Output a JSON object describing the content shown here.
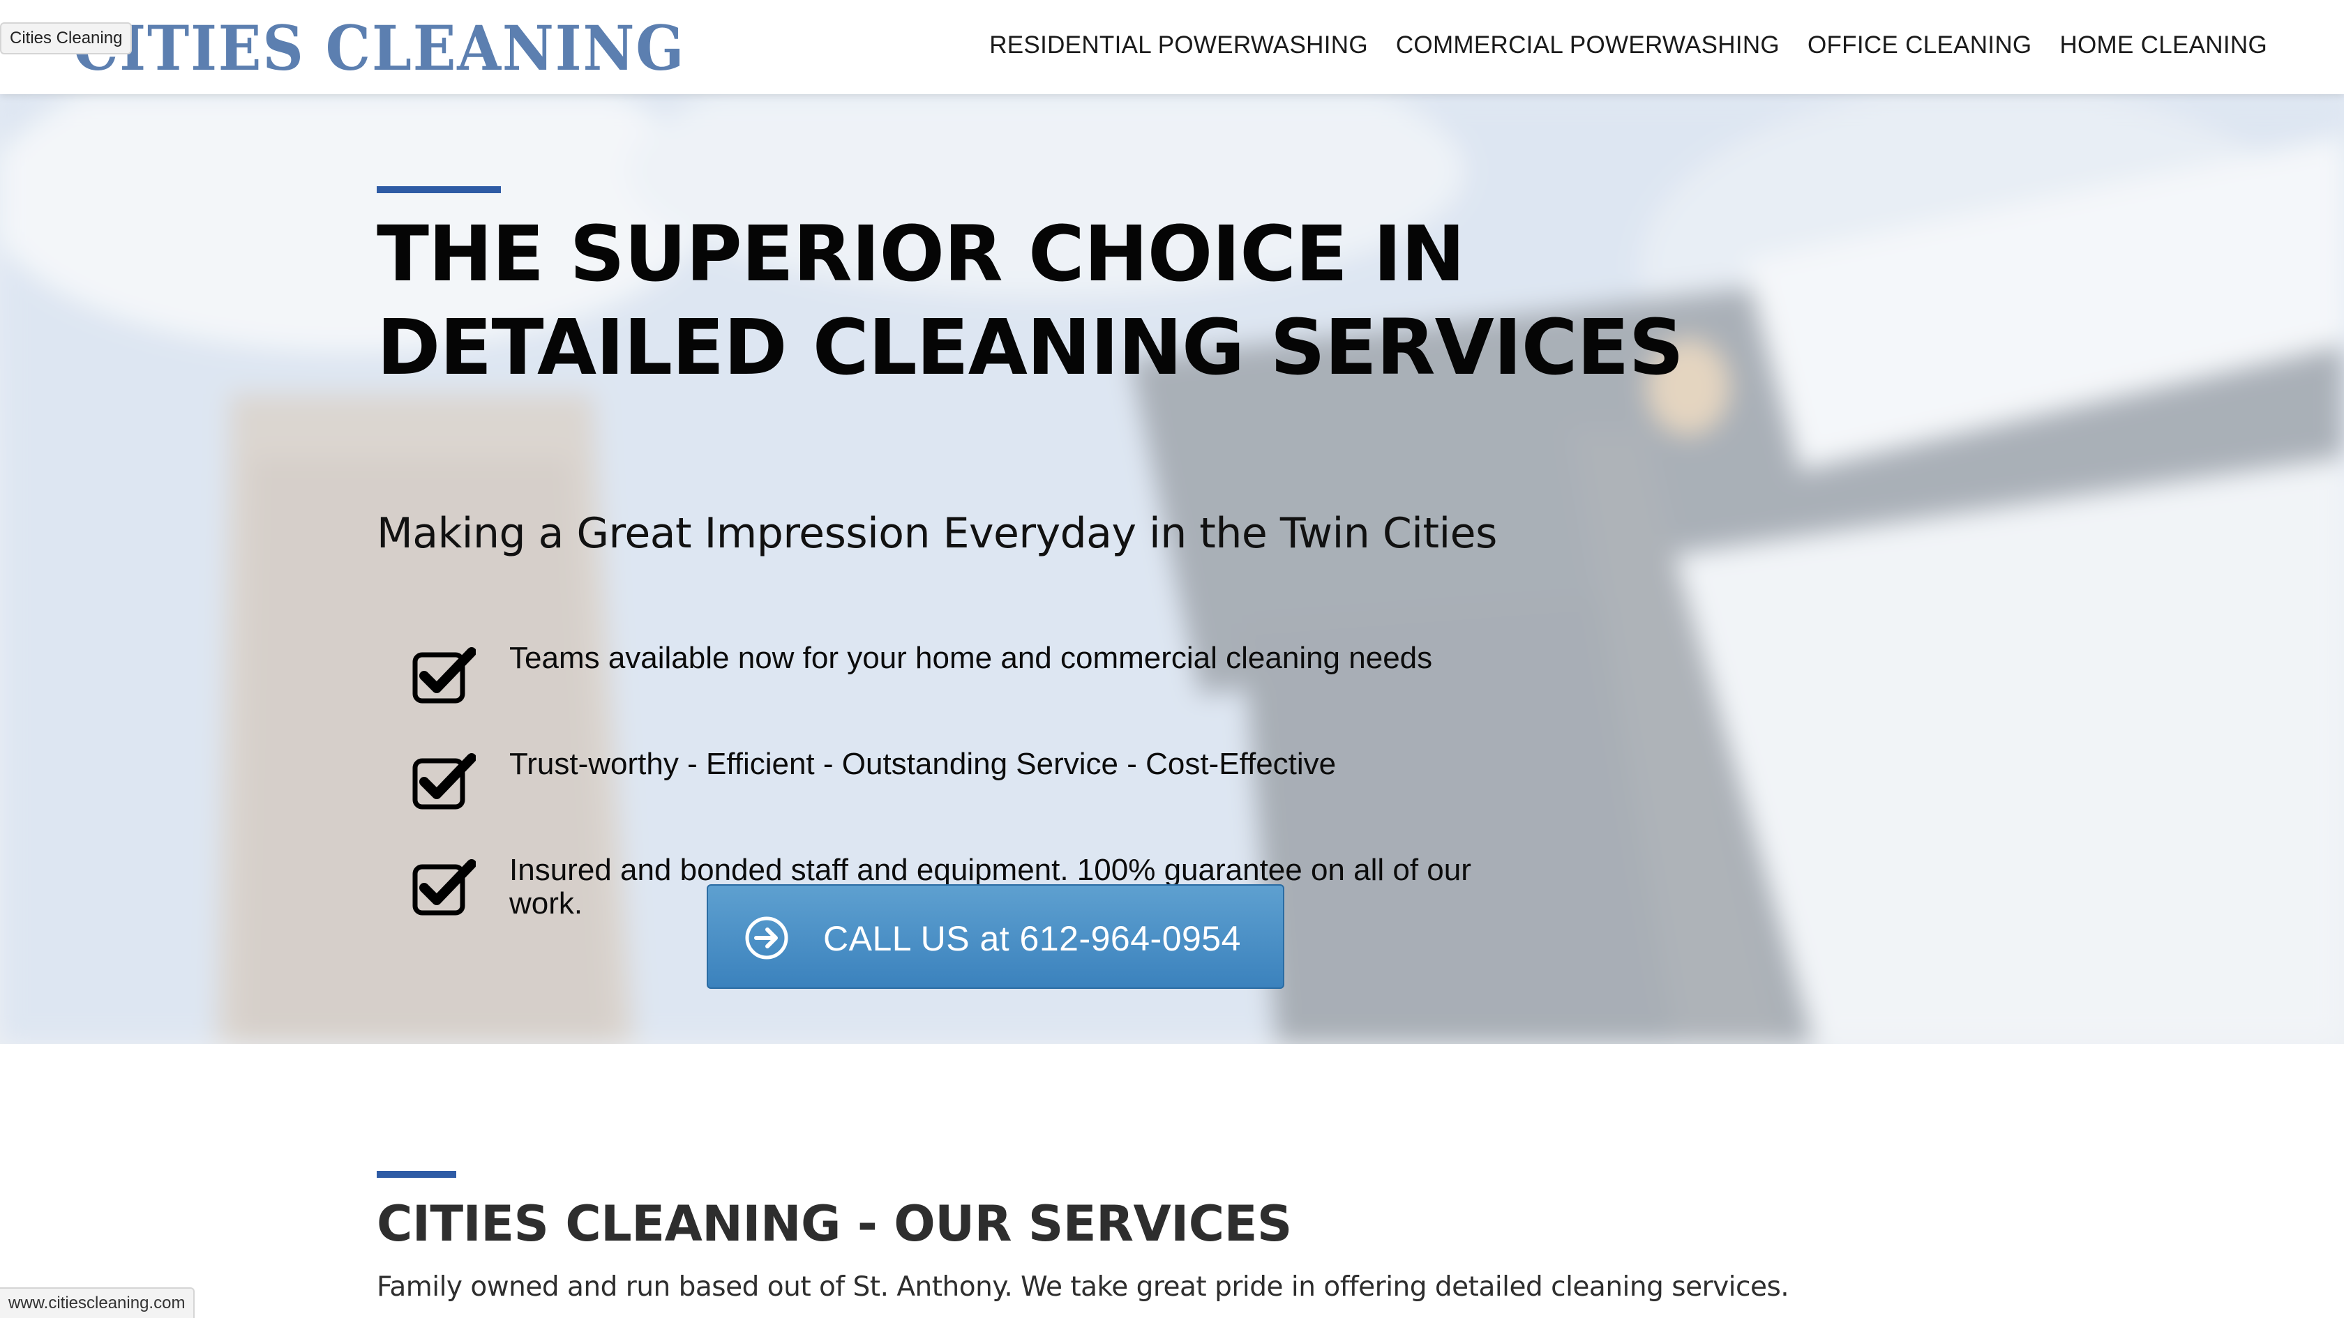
{
  "browser": {
    "tooltip": "Cities Cleaning",
    "status_url": "www.citiescleaning.com"
  },
  "header": {
    "logo_text": "CITIES CLEANING",
    "nav": [
      {
        "label": "RESIDENTIAL POWERWASHING"
      },
      {
        "label": "COMMERCIAL POWERWASHING"
      },
      {
        "label": "OFFICE CLEANING"
      },
      {
        "label": "HOME CLEANING"
      }
    ]
  },
  "hero": {
    "title_line1": "THE SUPERIOR CHOICE IN",
    "title_line2": "DETAILED CLEANING SERVICES",
    "subtitle": "Making a Great Impression Everyday in the Twin Cities",
    "features": [
      {
        "icon": "checkbox-checked-icon",
        "text": "Teams available now for your home and commercial cleaning needs"
      },
      {
        "icon": "checkbox-checked-icon",
        "text": "Trust-worthy - Efficient - Outstanding Service - Cost-Effective"
      },
      {
        "icon": "checkbox-checked-icon",
        "text": "Insured and bonded staff and equipment. 100% guarantee on all of our work."
      }
    ],
    "cta_label": "CALL US at 612-964-0954",
    "cta_icon": "arrow-circle-right-icon"
  },
  "services": {
    "title": "CITIES CLEANING - OUR SERVICES",
    "description": "Family owned and run based out of St. Anthony. We take great pride in offering detailed cleaning services."
  },
  "colors": {
    "brand_blue": "#2e5ba5",
    "logo_blue": "#5c7fb0",
    "cta_blue": "#4a90c8"
  }
}
